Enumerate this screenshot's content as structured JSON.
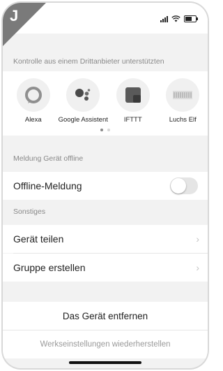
{
  "corner_badge": {
    "letter": "J"
  },
  "sections": {
    "third_party": "Kontrolle aus einem Drittanbieter unterstützten",
    "offline": "Meldung Gerät offline",
    "other": "Sonstiges"
  },
  "integrations": [
    {
      "label": "Alexa",
      "icon": "alexa-icon"
    },
    {
      "label": "Google Assistent",
      "icon": "google-assistant-icon"
    },
    {
      "label": "IFTTT",
      "icon": "ifttt-icon"
    },
    {
      "label": "Luchs Elf",
      "icon": "luchs-elf-icon"
    }
  ],
  "pager": {
    "pages": 2,
    "active": 1
  },
  "offline": {
    "label": "Offline-Meldung",
    "enabled": false
  },
  "other_items": [
    {
      "label": "Gerät teilen"
    },
    {
      "label": "Gruppe erstellen"
    }
  ],
  "actions": {
    "remove_device": "Das Gerät entfernen",
    "factory_reset": "Werkseinstellungen wiederherstellen"
  },
  "colors": {
    "background": "#f2f2f2",
    "card": "#ffffff",
    "muted_text": "#888888",
    "toggle_off": "#e5e5e5"
  }
}
